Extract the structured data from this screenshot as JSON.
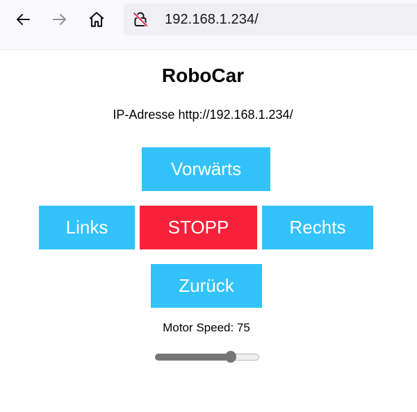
{
  "browser": {
    "url": "192.168.1.234/",
    "back_icon": "arrow-left-icon",
    "forward_icon": "arrow-right-icon",
    "home_icon": "home-icon",
    "security_icon": "insecure-lock-icon"
  },
  "page": {
    "title": "RoboCar",
    "ip_line": "IP-Adresse http://192.168.1.234/",
    "buttons": {
      "forward": "Vorwärts",
      "left": "Links",
      "stop": "STOPP",
      "right": "Rechts",
      "backward": "Zurück"
    },
    "speed_label": "Motor Speed: 75",
    "speed": {
      "value": 75,
      "min": 0,
      "max": 100
    }
  },
  "colors": {
    "button_blue": "#33c3fa",
    "button_red": "#f7223a"
  }
}
